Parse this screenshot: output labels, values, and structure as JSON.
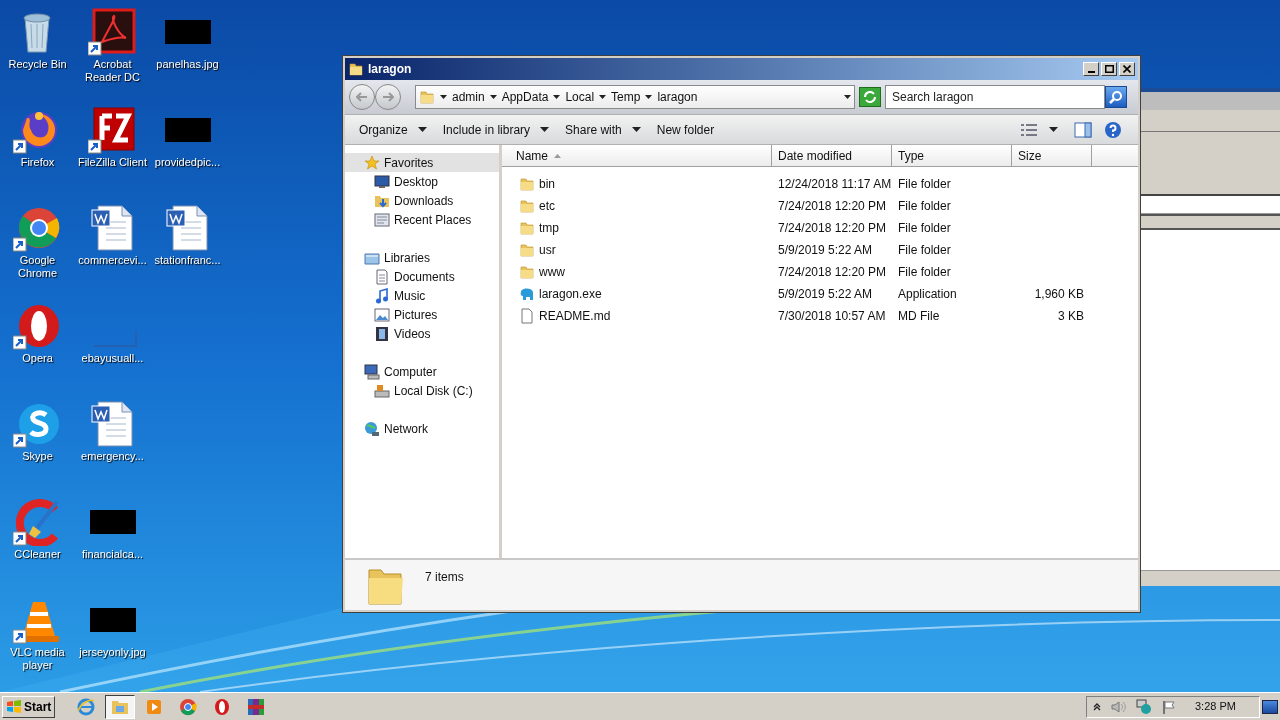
{
  "desktop": {
    "columns": [
      [
        {
          "label": "Recycle Bin",
          "kind": "recycle-bin",
          "shortcut": false
        },
        {
          "label": "Firefox",
          "kind": "firefox",
          "shortcut": true
        },
        {
          "label": "Google Chrome",
          "kind": "chrome",
          "shortcut": true
        },
        {
          "label": "Opera",
          "kind": "opera",
          "shortcut": true
        },
        {
          "label": "Skype",
          "kind": "skype",
          "shortcut": true
        },
        {
          "label": "CCleaner",
          "kind": "ccleaner",
          "shortcut": true
        },
        {
          "label": "VLC media player",
          "kind": "vlc",
          "shortcut": true
        }
      ],
      [
        {
          "label": "Acrobat Reader DC",
          "kind": "acrobat",
          "shortcut": true
        },
        {
          "label": "FileZilla Client",
          "kind": "filezilla",
          "shortcut": true
        },
        {
          "label": "commercevi...",
          "kind": "word",
          "shortcut": false
        },
        {
          "label": "ebayusuall...",
          "kind": "blank",
          "shortcut": false
        },
        {
          "label": "emergency...",
          "kind": "word",
          "shortcut": false
        },
        {
          "label": "financialca...",
          "kind": "redacted",
          "shortcut": false
        },
        {
          "label": "jerseyonly.jpg",
          "kind": "redacted",
          "shortcut": false
        }
      ],
      [
        {
          "label": "panelhas.jpg",
          "kind": "redacted",
          "shortcut": false
        },
        {
          "label": "providedpic...",
          "kind": "redacted",
          "shortcut": false
        },
        {
          "label": "stationfranc...",
          "kind": "word",
          "shortcut": false
        }
      ]
    ]
  },
  "explorer": {
    "title": "laragon",
    "address": [
      "admin",
      "AppData",
      "Local",
      "Temp",
      "laragon"
    ],
    "search": {
      "placeholder": "Search laragon"
    },
    "toolbar": [
      {
        "label": "Organize",
        "dropdown": true
      },
      {
        "label": "Include in library",
        "dropdown": true
      },
      {
        "label": "Share with",
        "dropdown": true
      },
      {
        "label": "New folder",
        "dropdown": false
      }
    ],
    "nav": [
      {
        "label": "Favorites",
        "kind": "star",
        "selected": true,
        "children": [
          {
            "label": "Desktop",
            "kind": "desktop",
            "selected": false
          },
          {
            "label": "Downloads",
            "kind": "downloads",
            "selected": false
          },
          {
            "label": "Recent Places",
            "kind": "recent",
            "selected": false
          }
        ]
      },
      {
        "label": "Libraries",
        "kind": "libraries",
        "selected": false,
        "children": [
          {
            "label": "Documents",
            "kind": "documents",
            "selected": false
          },
          {
            "label": "Music",
            "kind": "music",
            "selected": false
          },
          {
            "label": "Pictures",
            "kind": "pictures",
            "selected": false
          },
          {
            "label": "Videos",
            "kind": "videos",
            "selected": false
          }
        ]
      },
      {
        "label": "Computer",
        "kind": "computer",
        "selected": false,
        "children": [
          {
            "label": "Local Disk (C:)",
            "kind": "disk",
            "selected": false
          }
        ]
      },
      {
        "label": "Network",
        "kind": "network",
        "selected": false
      }
    ],
    "columns": [
      {
        "label": "Name",
        "sorted": true
      },
      {
        "label": "Date modified",
        "sorted": false
      },
      {
        "label": "Type",
        "sorted": false
      },
      {
        "label": "Size",
        "sorted": false
      }
    ],
    "files": [
      {
        "name": "bin",
        "date": "12/24/2018 11:17 AM",
        "type": "File folder",
        "kind": "folder"
      },
      {
        "name": "etc",
        "date": "7/24/2018 12:20 PM",
        "type": "File folder",
        "kind": "folder"
      },
      {
        "name": "tmp",
        "date": "7/24/2018 12:20 PM",
        "type": "File folder",
        "kind": "folder"
      },
      {
        "name": "usr",
        "date": "5/9/2019 5:22 AM",
        "type": "File folder",
        "kind": "folder"
      },
      {
        "name": "www",
        "date": "7/24/2018 12:20 PM",
        "type": "File folder",
        "kind": "folder"
      },
      {
        "name": "laragon.exe",
        "date": "5/9/2019 5:22 AM",
        "type": "Application",
        "size": "1,960 KB",
        "kind": "app"
      },
      {
        "name": "README.md",
        "date": "7/30/2018 10:57 AM",
        "type": "MD File",
        "size": "3 KB",
        "kind": "file"
      }
    ],
    "details": "7 items"
  },
  "taskbar": {
    "start": "Start",
    "apps": [
      {
        "kind": "ie",
        "selected": false
      },
      {
        "kind": "explorer",
        "selected": true
      },
      {
        "kind": "media",
        "selected": false
      },
      {
        "kind": "chrome",
        "selected": false
      },
      {
        "kind": "opera",
        "selected": false
      },
      {
        "kind": "winrar",
        "selected": false
      }
    ],
    "clock": "3:28 PM"
  }
}
